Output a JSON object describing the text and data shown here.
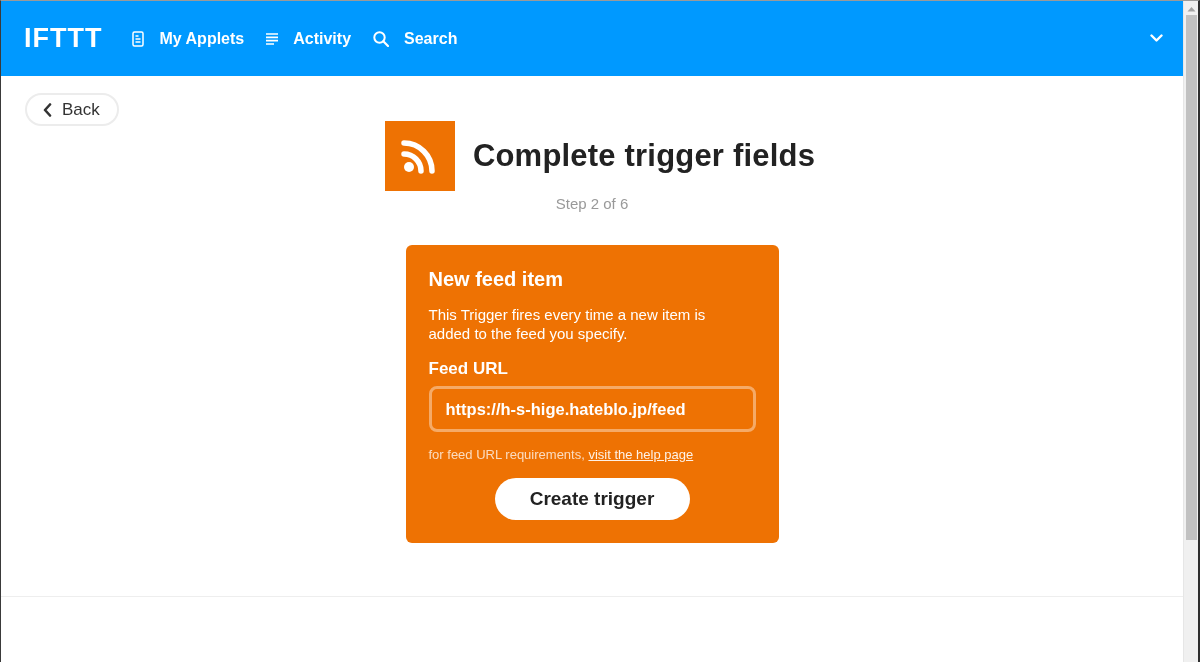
{
  "nav": {
    "logo": "IFTTT",
    "items": [
      {
        "label": "My Applets",
        "kind": "applets"
      },
      {
        "label": "Activity",
        "kind": "activity"
      },
      {
        "label": "Search",
        "kind": "search"
      }
    ]
  },
  "back_button": {
    "label": "Back"
  },
  "header": {
    "title": "Complete trigger fields",
    "step": "Step 2 of 6"
  },
  "trigger": {
    "title": "New feed item",
    "description": "This Trigger fires every time a new item is added to the feed you specify.",
    "field": {
      "label": "Feed URL",
      "value": "https://h-s-hige.hateblo.jp/feed"
    },
    "help": {
      "text": "for feed URL requirements, ",
      "link": "visit the help page"
    },
    "button": "Create trigger"
  }
}
